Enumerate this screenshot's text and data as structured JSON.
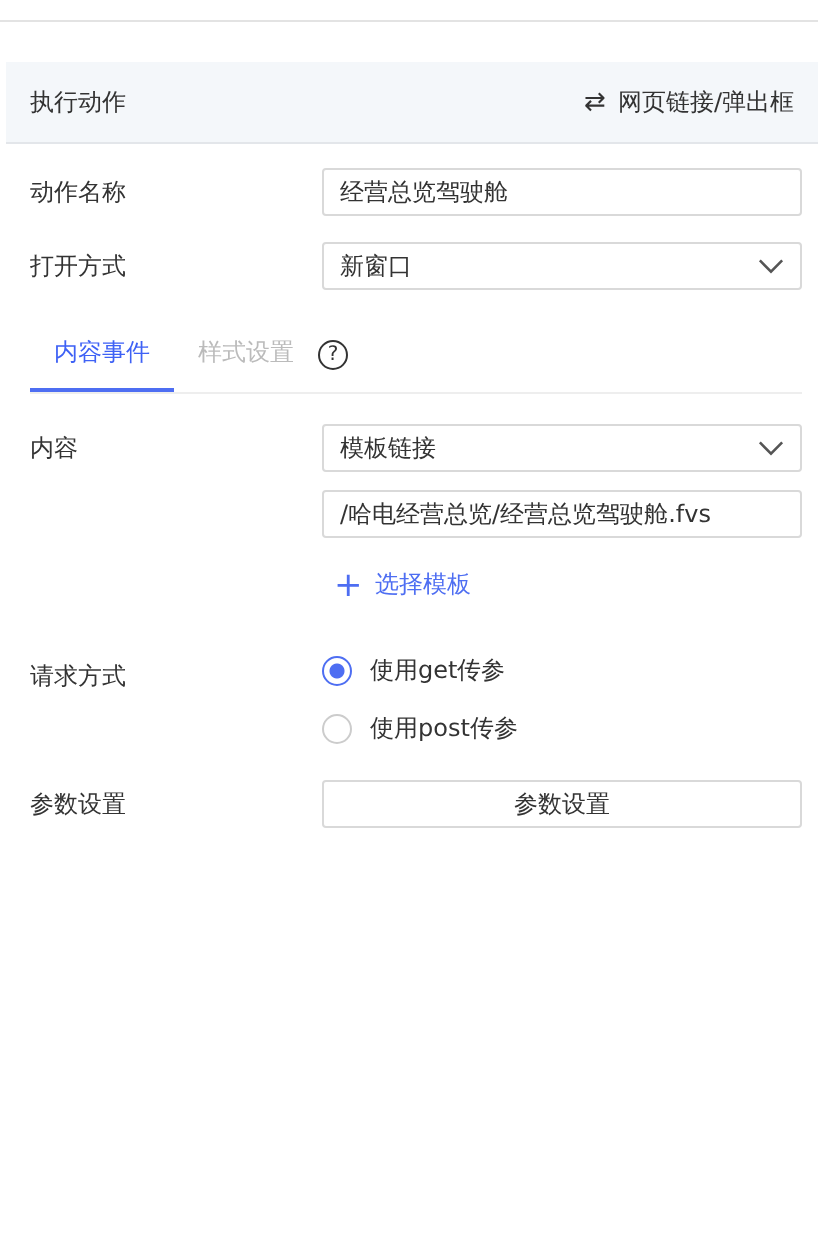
{
  "header": {
    "title": "执行动作",
    "action_icon": "⇄",
    "action": "网页链接/弹出框"
  },
  "fields": [
    {
      "label": "动作名称",
      "kind": "input",
      "value": "经营总览驾驶舱"
    },
    {
      "label": "打开方式",
      "kind": "select",
      "value": "新窗口"
    }
  ],
  "tab_help_icon": "?",
  "tabs": [
    {
      "label": "内容事件",
      "selected": true
    },
    {
      "label": "样式设置",
      "selected": false
    }
  ],
  "content": {
    "label": "内容",
    "select": "模板链接",
    "path": "/哈电经营总览/经营总览驾驶舱.fvs",
    "add_icon": "+",
    "add_link": "选择模板"
  },
  "request": {
    "label": "请求方式",
    "options": [
      {
        "label": "使用get传参",
        "selected": true
      },
      {
        "label": "使用post传参",
        "selected": false
      }
    ]
  },
  "params": {
    "label": "参数设置",
    "button": "参数设置"
  }
}
